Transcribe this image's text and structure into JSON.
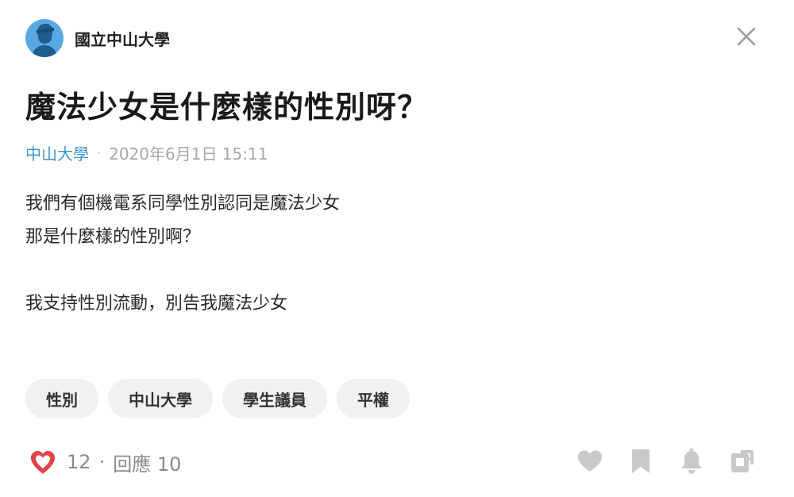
{
  "header": {
    "board_name": "國立中山大學"
  },
  "post": {
    "title": "魔法少女是什麼樣的性別呀？",
    "author": "中山大學",
    "separator": "·",
    "timestamp": "2020年6月1日 15:11",
    "body_lines": [
      "我們有個機電系同學性別認同是魔法少女",
      "那是什麼樣的性別啊？",
      "我支持性別流動，別告我魔法少女"
    ]
  },
  "tags": [
    "性別",
    "中山大學",
    "學生議員",
    "平權"
  ],
  "stats": {
    "likes": "12",
    "separator": "·",
    "replies_label": "回應 10"
  },
  "icons": {
    "like": "heart-icon",
    "close": "close-icon",
    "actions": [
      "heart-outline-icon",
      "bookmark-icon",
      "bell-icon",
      "share-icon"
    ]
  },
  "colors": {
    "accent_blue": "#3f97c9",
    "avatar_bg": "#5aa8e2",
    "heart_red": "#e2434a",
    "action_gray": "#c9c9c9",
    "tag_bg": "#f1f1f1"
  }
}
